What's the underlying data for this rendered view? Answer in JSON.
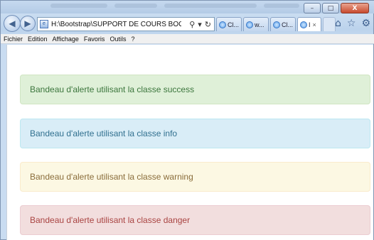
{
  "window": {
    "controls": {
      "minimize": "–",
      "maximize": "□",
      "close": "X"
    }
  },
  "navbar": {
    "back_icon": "back-arrow-icon",
    "forward_icon": "forward-arrow-icon",
    "address": "H:\\Bootstrap\\SUPPORT DE COURS BOOTSTI",
    "search_glyph": "⚲",
    "dropdown_glyph": "▾",
    "refresh_glyph": "↻",
    "tabs": [
      {
        "label": "Cl...",
        "active": false
      },
      {
        "label": "w...",
        "active": false
      },
      {
        "label": "Cl...",
        "active": false
      },
      {
        "label": "I",
        "active": true,
        "close": "×"
      }
    ],
    "right_icons": {
      "home": "⌂",
      "favorites": "☆",
      "settings": "⚙"
    }
  },
  "menubar": {
    "items": [
      "Fichier",
      "Edition",
      "Affichage",
      "Favoris",
      "Outils",
      "?"
    ]
  },
  "alerts": [
    {
      "type": "success",
      "text": "Bandeau d'alerte utilisant la classe success",
      "bg": "#dff0d8",
      "color": "#3c763d"
    },
    {
      "type": "info",
      "text": "Bandeau d'alerte utilisant la classe info",
      "bg": "#d9edf7",
      "color": "#31708f"
    },
    {
      "type": "warning",
      "text": "Bandeau d'alerte utilisant la classe warning",
      "bg": "#fcf8e3",
      "color": "#8a6d3b"
    },
    {
      "type": "danger",
      "text": "Bandeau d'alerte utilisant la classe danger",
      "bg": "#f2dede",
      "color": "#a94442"
    }
  ]
}
